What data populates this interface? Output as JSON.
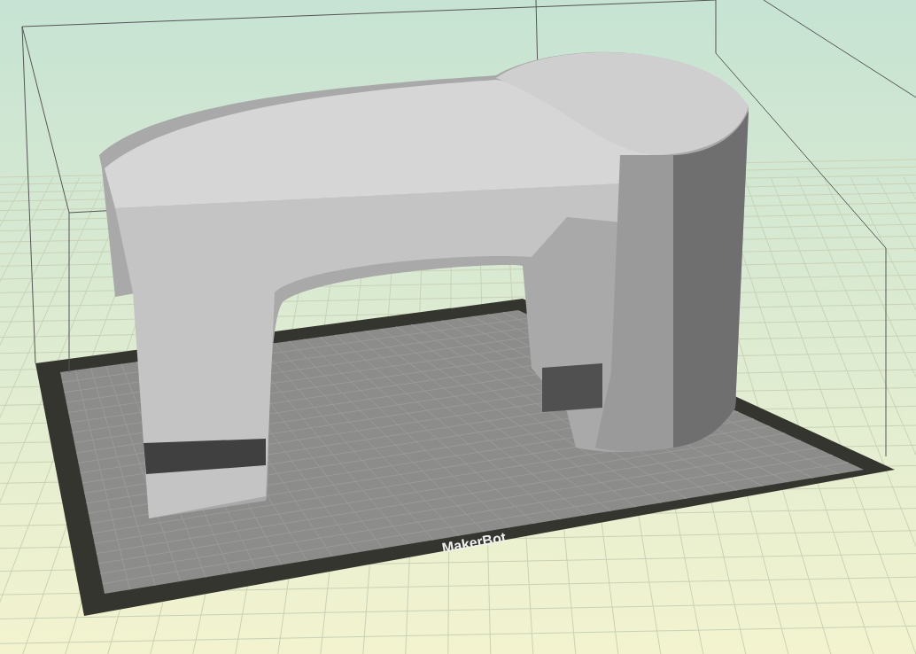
{
  "build_plate": {
    "logo": "MakerBot"
  }
}
